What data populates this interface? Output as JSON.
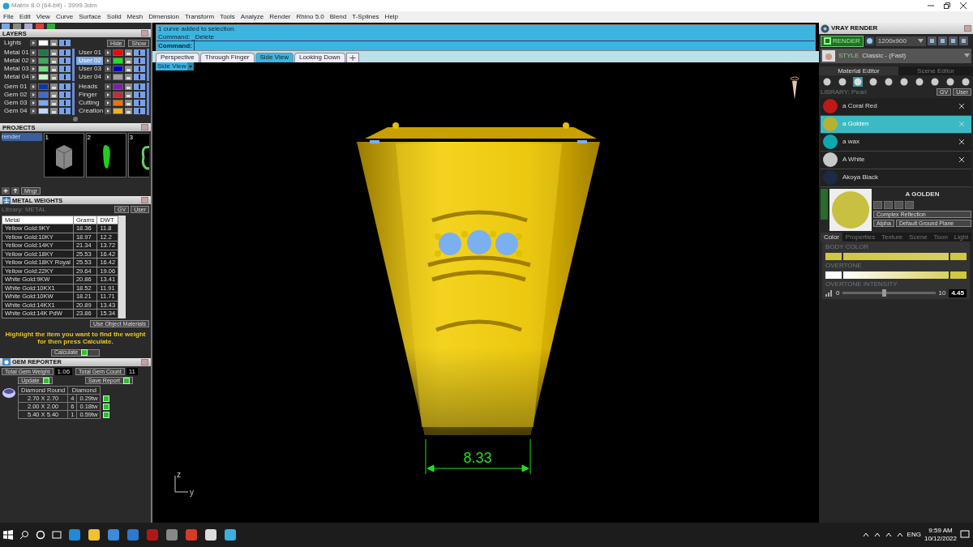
{
  "window": {
    "title": "Matrix 8.0 (64-bit) - 3999.3dm"
  },
  "menu": [
    "File",
    "Edit",
    "View",
    "Curve",
    "Surface",
    "Solid",
    "Mesh",
    "Dimension",
    "Transform",
    "Tools",
    "Analyze",
    "Render",
    "Rhino 5.0",
    "Blend",
    "T-Splines",
    "Help"
  ],
  "layers": {
    "title": "LAYERS",
    "lights": {
      "name": "Lights",
      "color": "#ffffff"
    },
    "hide": "Hide",
    "show": "Show",
    "columns": [
      {
        "groups": [
          {
            "layers": [
              {
                "name": "Metal 01",
                "color": "#1a7a4a",
                "selected": false
              },
              {
                "name": "Metal 02",
                "color": "#3caa5c",
                "selected": false
              },
              {
                "name": "Metal 03",
                "color": "#6ee07a",
                "selected": false
              },
              {
                "name": "Metal 04",
                "color": "#c4f7c4",
                "selected": false
              }
            ]
          },
          {
            "layers": [
              {
                "name": "Gem 01",
                "color": "#0a3aa0",
                "selected": false
              },
              {
                "name": "Gem 02",
                "color": "#3a6ed0",
                "selected": false
              },
              {
                "name": "Gem 03",
                "color": "#7aaaf0",
                "selected": false
              },
              {
                "name": "Gem 04",
                "color": "#c0d8f8",
                "selected": false
              }
            ]
          }
        ]
      },
      {
        "groups": [
          {
            "layers": [
              {
                "name": "User 01",
                "color": "#ff0000",
                "selected": false
              },
              {
                "name": "User 02",
                "color": "#22dd22",
                "selected": true
              },
              {
                "name": "User 03",
                "color": "#0000cc",
                "selected": false
              },
              {
                "name": "User 04",
                "color": "#a0a0a0",
                "selected": false
              }
            ]
          },
          {
            "layers": [
              {
                "name": "Heads",
                "color": "#7a22aa",
                "selected": false
              },
              {
                "name": "Finger",
                "color": "#c03030",
                "selected": false
              },
              {
                "name": "Cutting",
                "color": "#f07010",
                "selected": false
              },
              {
                "name": "Creation",
                "color": "#f0b020",
                "selected": false
              }
            ]
          }
        ]
      }
    ]
  },
  "projects": {
    "title": "PROJECTS",
    "items": [
      {
        "label": "render",
        "selected": true
      }
    ],
    "thumbnails": [
      {
        "number": "1",
        "kind": "box"
      },
      {
        "number": "2",
        "kind": "drop"
      },
      {
        "number": "3",
        "kind": "ring"
      }
    ],
    "manager": "Mngr"
  },
  "metal_weights": {
    "title": "METAL WEIGHTS",
    "library": "Library: METAL",
    "gv": "GV",
    "user": "User",
    "columns": [
      "Metal",
      "Grams",
      "DWT"
    ],
    "rows": [
      [
        "Yellow Gold:9KY",
        "18.36",
        "11.8"
      ],
      [
        "Yellow Gold:10KY",
        "18.97",
        "12.2"
      ],
      [
        "Yellow Gold:14KY",
        "21.34",
        "13.72"
      ],
      [
        "Yellow Gold:18KY",
        "25.53",
        "16.42"
      ],
      [
        "Yellow Gold:18KY Royal",
        "25.53",
        "16.42"
      ],
      [
        "Yellow Gold:22KY",
        "29.64",
        "19.06"
      ],
      [
        "White Gold:9KW",
        "20.86",
        "13.41"
      ],
      [
        "White Gold:10KX1",
        "18.52",
        "11.91"
      ],
      [
        "White Gold:10KW",
        "18.21",
        "11.71"
      ],
      [
        "White Gold:14KX1",
        "20.89",
        "13.43"
      ],
      [
        "White Gold:14K PdW",
        "23.86",
        "15.34"
      ]
    ],
    "use_object_materials": "Use Object Materials",
    "hint": "Highlight the item you want to find the weight for then press Calculate.",
    "calculate": "Calculate"
  },
  "gem_reporter": {
    "title": "GEM REPORTER",
    "stats": [
      {
        "label": "Total Gem Weight",
        "value": "1.06"
      },
      {
        "label": "Total Gem Count",
        "value": "11"
      }
    ],
    "buttons": [
      "Update",
      "Save Report"
    ],
    "columns": [
      "Diamond Round",
      "Diamond"
    ],
    "rows": [
      {
        "size": "2.70 X 2.70",
        "count": "4",
        "weight": "0.29tw"
      },
      {
        "size": "2.00 X 2.00",
        "count": "6",
        "weight": "0.18tw"
      },
      {
        "size": "5.40 X 5.40",
        "count": "1",
        "weight": "0.59tw"
      }
    ]
  },
  "command": {
    "history": [
      "1 curve added to selection.",
      "Command: _Delete"
    ],
    "prompt": "Command:"
  },
  "viewport": {
    "tabs": [
      {
        "label": "Perspective",
        "selected": false
      },
      {
        "label": "Through Finger",
        "selected": false
      },
      {
        "label": "Side View",
        "selected": true
      },
      {
        "label": "Looking Down",
        "selected": false
      }
    ],
    "view_menu": "Side View",
    "axes": {
      "vertical": "z",
      "horizontal": "y"
    },
    "dimension": "8.33"
  },
  "vray": {
    "title": "VRAY RENDER",
    "render": "RENDER",
    "resolution": "1200x900",
    "style_label": "STYLE",
    "style": "Classic - (Fast)",
    "editor_tabs": [
      {
        "label": "Material Editor",
        "selected": true
      },
      {
        "label": "Scene Editor",
        "selected": false
      }
    ],
    "library": "LIBRARY: Pearl",
    "gv": "GV",
    "user": "User",
    "materials": [
      {
        "name": "a Coral Red",
        "color": "#c01818",
        "selected": false,
        "removable": true
      },
      {
        "name": "a Golden",
        "color": "#b8b030",
        "selected": true,
        "removable": true
      },
      {
        "name": "a wax",
        "color": "#10a8b0",
        "selected": false,
        "removable": true
      },
      {
        "name": "A White",
        "color": "#c8c8c8",
        "selected": false,
        "removable": true
      },
      {
        "name": "Akoya Black",
        "color": "#1c2a44",
        "selected": false,
        "removable": false
      }
    ],
    "preview": {
      "name": "A GOLDEN",
      "color": "#c8c040",
      "reflection": "Complex Reflection",
      "alpha": "Alpha",
      "ground": "Default Ground Plane"
    },
    "property_tabs": [
      {
        "label": "Color",
        "selected": true
      },
      {
        "label": "Properties",
        "selected": false
      },
      {
        "label": "Texture",
        "selected": false
      },
      {
        "label": "Scene",
        "selected": false
      },
      {
        "label": "Toon",
        "selected": false
      },
      {
        "label": "Light",
        "selected": false
      }
    ],
    "body_color": "BODY COLOR",
    "overtone": "OVERTONE",
    "intensity": {
      "label": "OVERTONE INTENSITY",
      "min": "0",
      "max": "10",
      "value": "4.45",
      "level": 0.445
    }
  },
  "taskbar": {
    "language": "ENG",
    "time": "9:59 AM",
    "date": "10/12/2022"
  }
}
